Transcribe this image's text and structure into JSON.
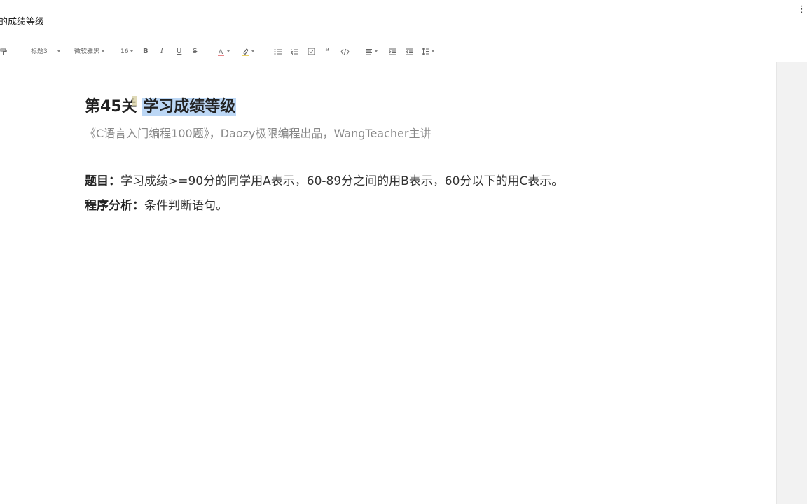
{
  "window": {
    "doc_title": "的成绩等级",
    "more_icon": "more-vertical-icon"
  },
  "toolbar": {
    "format_painter_icon": "format-painter-icon",
    "heading_style": "标题3",
    "font_family": "微软雅黑",
    "font_size": "16",
    "bold_icon": "bold-icon",
    "italic_icon": "italic-icon",
    "underline_icon": "underline-icon",
    "strike_icon": "strikethrough-icon",
    "font_color_icon": "font-color-icon",
    "highlight_icon": "highlight-icon",
    "bullet_list_icon": "bullet-list-icon",
    "numbered_list_icon": "numbered-list-icon",
    "checklist_icon": "checklist-icon",
    "quote_icon": "quote-icon",
    "code_icon": "code-icon",
    "align_icon": "align-left-icon",
    "indent_icon": "indent-icon",
    "outdent_icon": "outdent-icon",
    "line_height_icon": "line-height-icon",
    "accent_red": "#d9363e",
    "accent_yellow": "#e0b400"
  },
  "document": {
    "heading_prefix": "第45关",
    "heading_selected": "学习成绩等级",
    "subtitle": "《C语言入门编程100题》，Daozy极限编程出品，WangTeacher主讲",
    "problem_label": "题目：",
    "problem_text": "学习成绩>=90分的同学用A表示，60-89分之间的用B表示，60分以下的用C表示。",
    "analysis_label": "程序分析：",
    "analysis_text": "条件判断语句。",
    "selection_color": "#bcd7f5"
  }
}
